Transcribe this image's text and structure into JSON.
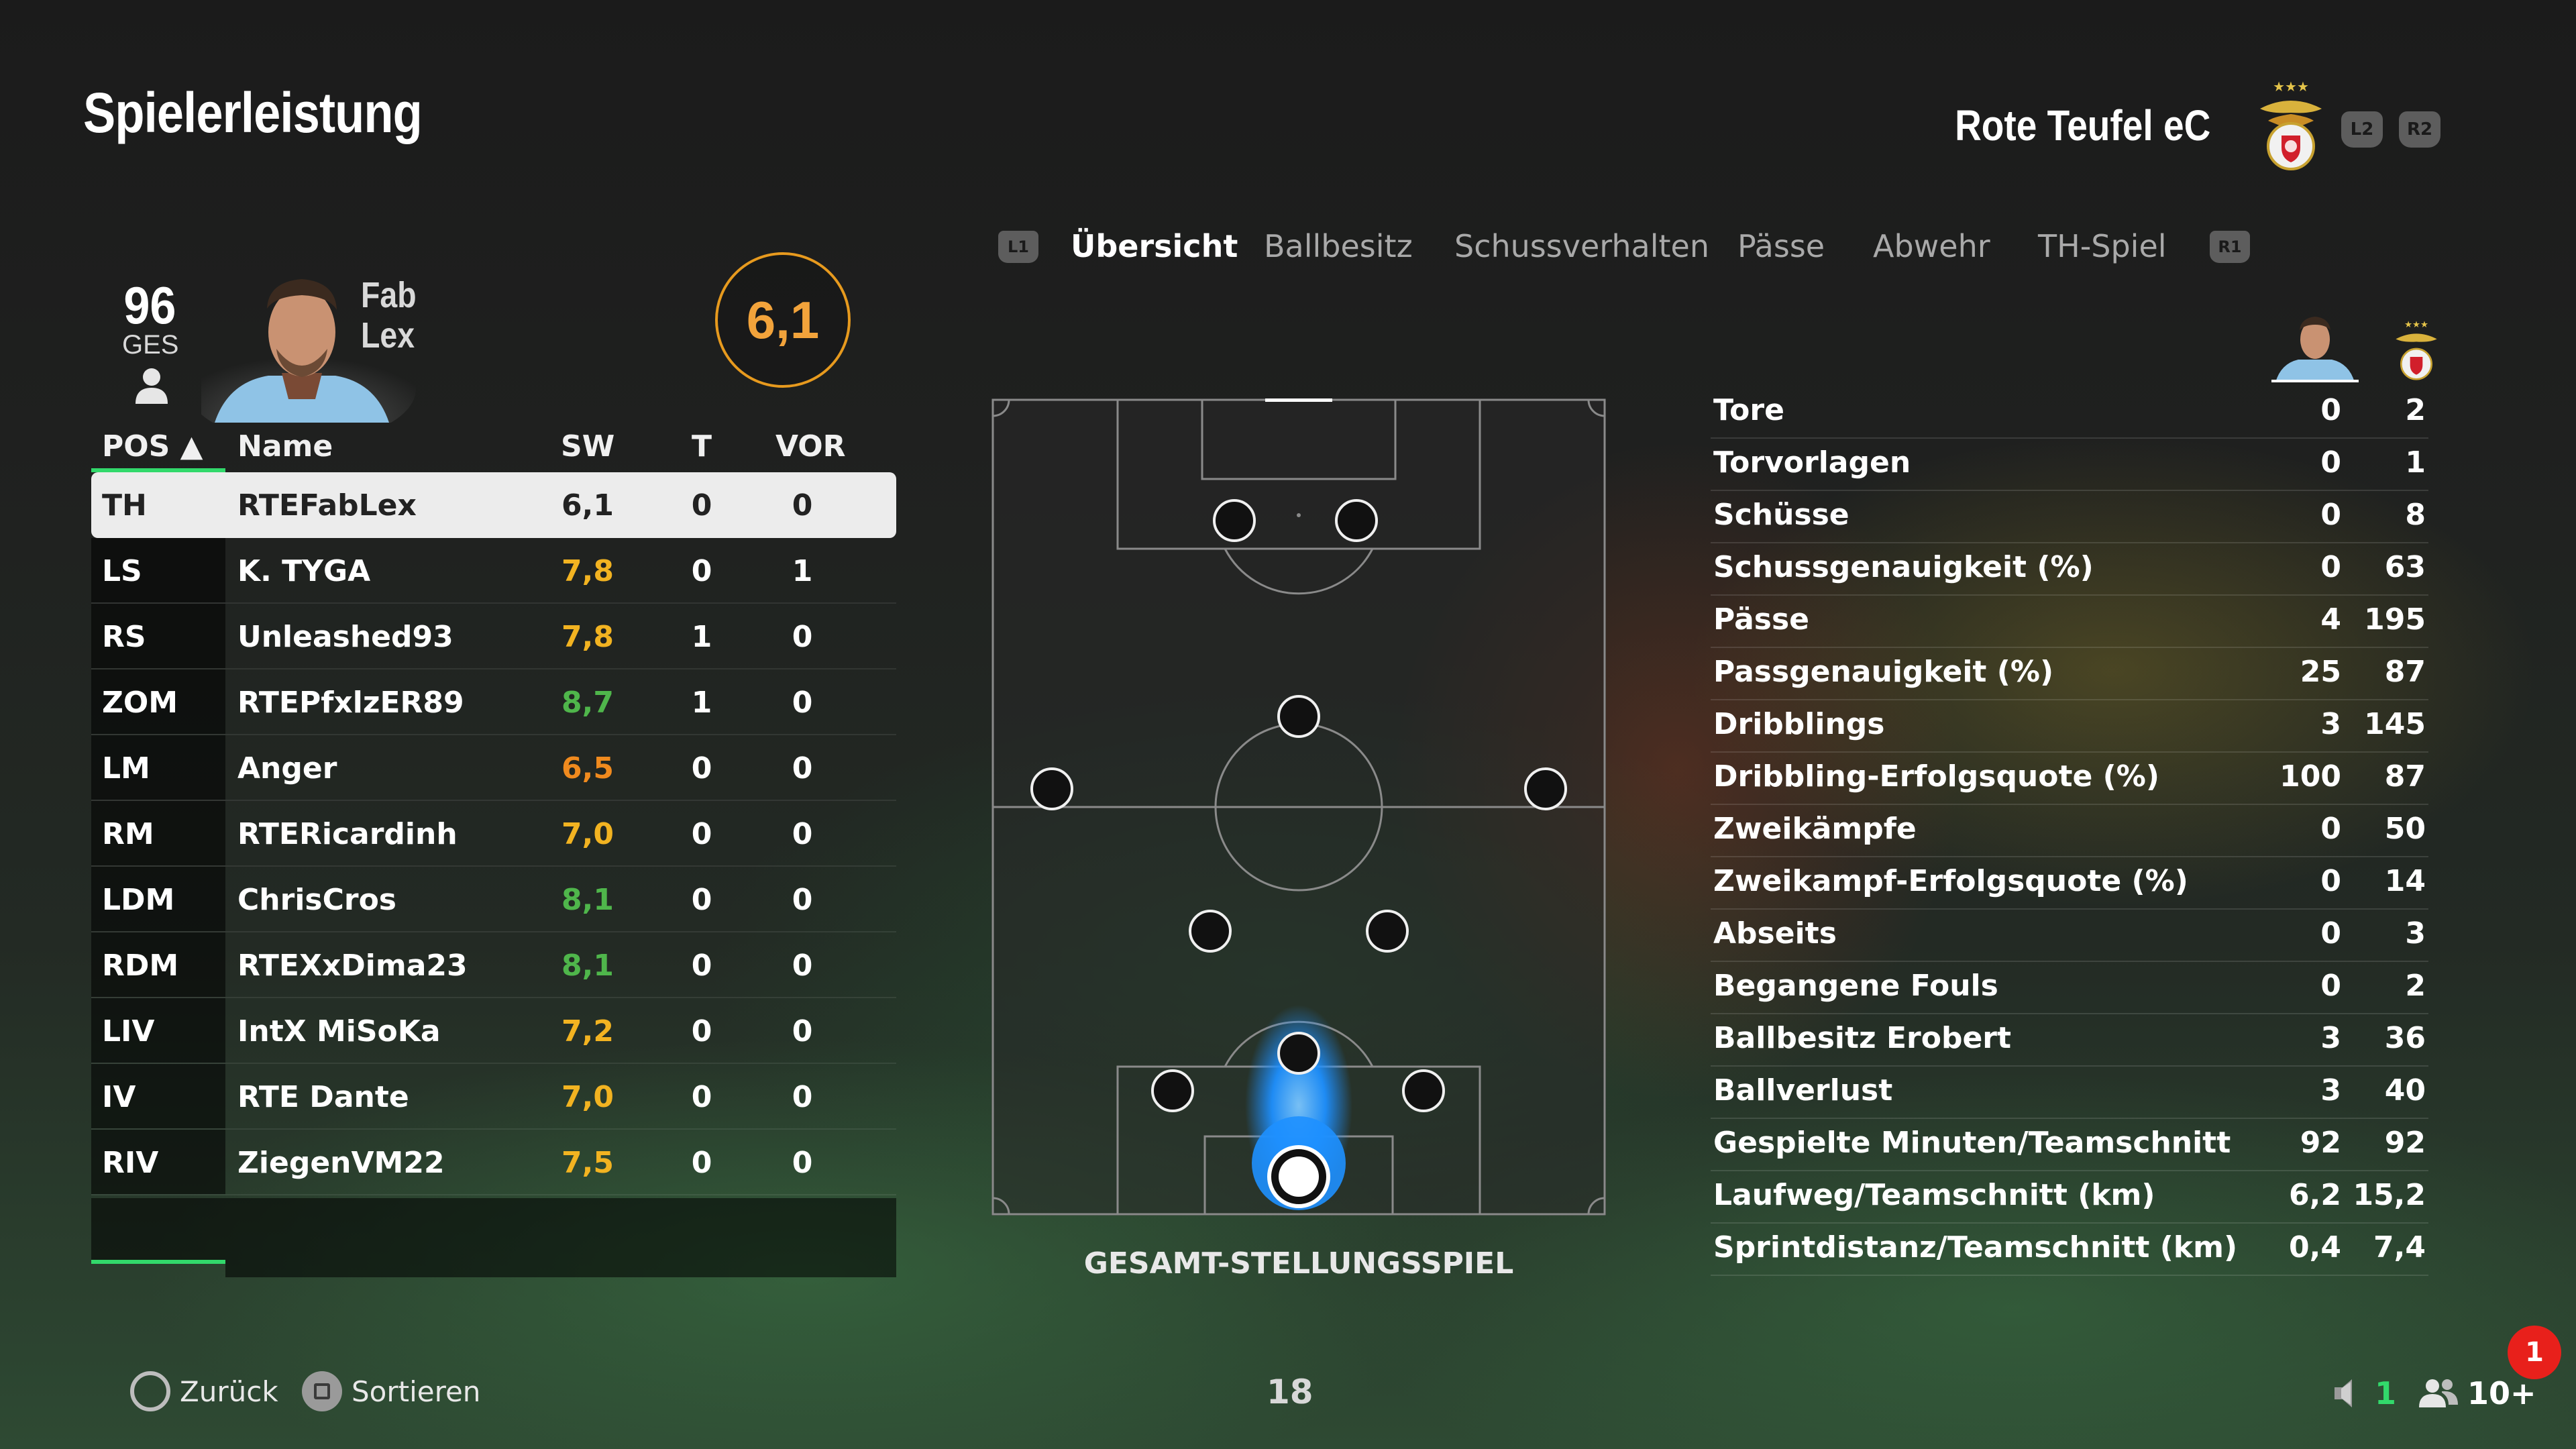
{
  "header": {
    "title": "Spielerleistung",
    "team_name": "Rote Teufel eC",
    "l2": "L2",
    "r2": "R2"
  },
  "player": {
    "overall": "96",
    "overall_label": "GES",
    "name_first": "Fab",
    "name_last": "Lex",
    "rating": "6,1"
  },
  "table": {
    "columns": {
      "pos": "POS ▲",
      "name": "Name",
      "sw": "SW",
      "t": "T",
      "vor": "VOR"
    },
    "rows": [
      {
        "pos": "TH",
        "name": "RTEFabLex",
        "sw": "6,1",
        "t": "0",
        "vor": "0",
        "sw_color": "#222222"
      },
      {
        "pos": "LS",
        "name": "K. TYGA",
        "sw": "7,8",
        "t": "0",
        "vor": "1",
        "sw_color": "#f2b321"
      },
      {
        "pos": "RS",
        "name": "Unleashed93",
        "sw": "7,8",
        "t": "1",
        "vor": "0",
        "sw_color": "#f2b321"
      },
      {
        "pos": "ZOM",
        "name": "RTEPfxlzER89",
        "sw": "8,7",
        "t": "1",
        "vor": "0",
        "sw_color": "#4fb64b"
      },
      {
        "pos": "LM",
        "name": "Anger",
        "sw": "6,5",
        "t": "0",
        "vor": "0",
        "sw_color": "#f08a1e"
      },
      {
        "pos": "RM",
        "name": "RTERicardinh",
        "sw": "7,0",
        "t": "0",
        "vor": "0",
        "sw_color": "#f2b321"
      },
      {
        "pos": "LDM",
        "name": "ChrisCros",
        "sw": "8,1",
        "t": "0",
        "vor": "0",
        "sw_color": "#4fb64b"
      },
      {
        "pos": "RDM",
        "name": "RTEXxDima23",
        "sw": "8,1",
        "t": "0",
        "vor": "0",
        "sw_color": "#4fb64b"
      },
      {
        "pos": "LIV",
        "name": "IntX MiSoKa",
        "sw": "7,2",
        "t": "0",
        "vor": "0",
        "sw_color": "#f2b321"
      },
      {
        "pos": "IV",
        "name": "RTE Dante",
        "sw": "7,0",
        "t": "0",
        "vor": "0",
        "sw_color": "#f2b321"
      },
      {
        "pos": "RIV",
        "name": "ZiegenVM22",
        "sw": "7,5",
        "t": "0",
        "vor": "0",
        "sw_color": "#f2b321"
      }
    ]
  },
  "tabs": {
    "l1": "L1",
    "r1": "R1",
    "items": [
      "Übersicht",
      "Ballbesitz",
      "Schussverhalten",
      "Pässe",
      "Abwehr",
      "TH-Spiel"
    ],
    "active_index": 0
  },
  "pitch": {
    "caption": "GESAMT-STELLUNGSSPIEL"
  },
  "stats": [
    {
      "label": "Tore",
      "player": "0",
      "team": "2"
    },
    {
      "label": "Torvorlagen",
      "player": "0",
      "team": "1"
    },
    {
      "label": "Schüsse",
      "player": "0",
      "team": "8"
    },
    {
      "label": "Schussgenauigkeit (%)",
      "player": "0",
      "team": "63"
    },
    {
      "label": "Pässe",
      "player": "4",
      "team": "195"
    },
    {
      "label": "Passgenauigkeit (%)",
      "player": "25",
      "team": "87"
    },
    {
      "label": "Dribblings",
      "player": "3",
      "team": "145"
    },
    {
      "label": "Dribbling-Erfolgsquote (%)",
      "player": "100",
      "team": "87"
    },
    {
      "label": "Zweikämpfe",
      "player": "0",
      "team": "50"
    },
    {
      "label": "Zweikampf-Erfolgsquote (%)",
      "player": "0",
      "team": "14"
    },
    {
      "label": "Abseits",
      "player": "0",
      "team": "3"
    },
    {
      "label": "Begangene Fouls",
      "player": "0",
      "team": "2"
    },
    {
      "label": "Ballbesitz Erobert",
      "player": "3",
      "team": "36"
    },
    {
      "label": "Ballverlust",
      "player": "3",
      "team": "40"
    },
    {
      "label": "Gespielte Minuten/Teamschnitt",
      "player": "92",
      "team": "92"
    },
    {
      "label": "Laufweg/Teamschnitt (km)",
      "player": "6,2",
      "team": "15,2"
    },
    {
      "label": "Sprintdistanz/Teamschnitt (km)",
      "player": "0,4",
      "team": "7,4"
    }
  ],
  "footer": {
    "back_label": "Zurück",
    "sort_label": "Sortieren",
    "page_number": "18",
    "notification_count": "1",
    "voice_count": "1",
    "party_count": "10+"
  },
  "colors": {
    "accent_green": "#32d96b",
    "rating_orange": "#e79a1e",
    "heat_blue": "#1e90ff"
  }
}
